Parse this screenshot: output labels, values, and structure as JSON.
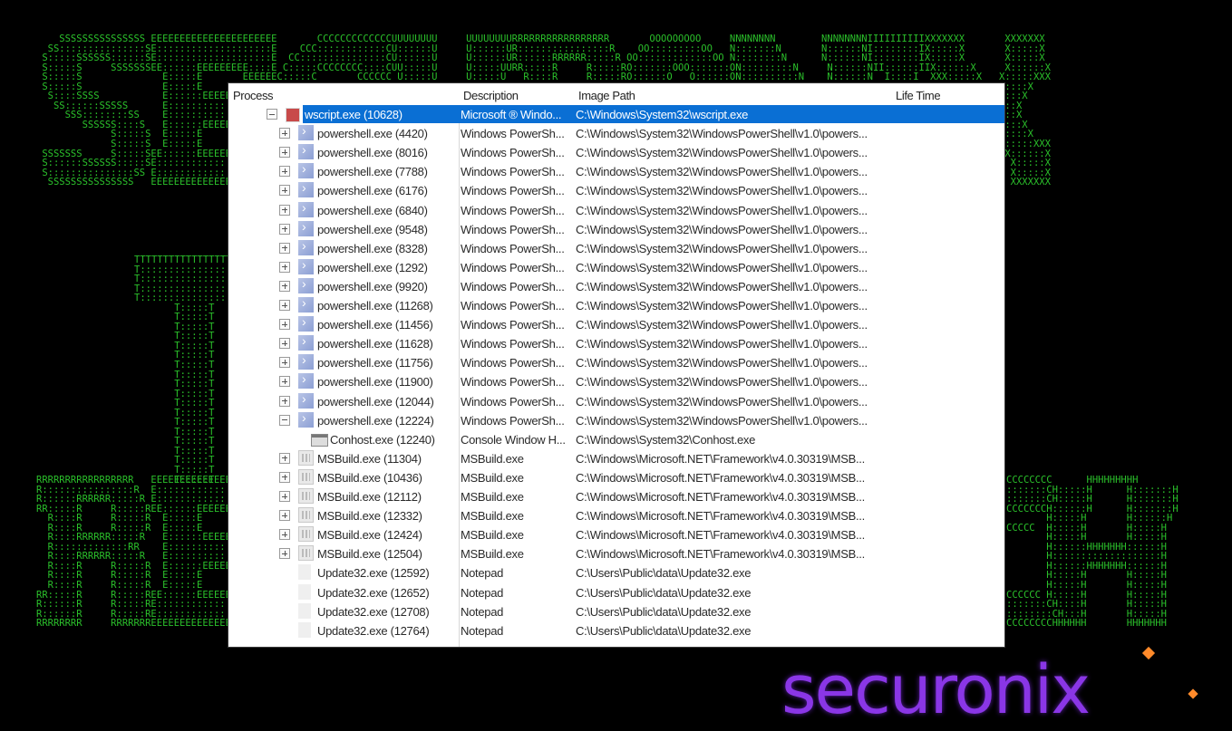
{
  "columns": {
    "process": "Process",
    "description": "Description",
    "image_path": "Image Path",
    "life_time": "Life Time"
  },
  "rows": [
    {
      "name": "wscript.exe (10628)",
      "desc": "Microsoft ® Windo...",
      "path": "C:\\Windows\\System32\\wscript.exe",
      "icon": "script-icon",
      "expander": "minus",
      "selected": true
    },
    {
      "name": "powershell.exe (4420)",
      "desc": "Windows PowerSh...",
      "path": "C:\\Windows\\System32\\WindowsPowerShell\\v1.0\\powers...",
      "icon": "powershell-icon",
      "expander": "plus"
    },
    {
      "name": "powershell.exe (8016)",
      "desc": "Windows PowerSh...",
      "path": "C:\\Windows\\System32\\WindowsPowerShell\\v1.0\\powers...",
      "icon": "powershell-icon",
      "expander": "plus"
    },
    {
      "name": "powershell.exe (7788)",
      "desc": "Windows PowerSh...",
      "path": "C:\\Windows\\System32\\WindowsPowerShell\\v1.0\\powers...",
      "icon": "powershell-icon",
      "expander": "plus"
    },
    {
      "name": "powershell.exe (6176)",
      "desc": "Windows PowerSh...",
      "path": "C:\\Windows\\System32\\WindowsPowerShell\\v1.0\\powers...",
      "icon": "powershell-icon",
      "expander": "plus"
    },
    {
      "name": "powershell.exe (6840)",
      "desc": "Windows PowerSh...",
      "path": "C:\\Windows\\System32\\WindowsPowerShell\\v1.0\\powers...",
      "icon": "powershell-icon",
      "expander": "plus"
    },
    {
      "name": "powershell.exe (9548)",
      "desc": "Windows PowerSh...",
      "path": "C:\\Windows\\System32\\WindowsPowerShell\\v1.0\\powers...",
      "icon": "powershell-icon",
      "expander": "plus"
    },
    {
      "name": "powershell.exe (8328)",
      "desc": "Windows PowerSh...",
      "path": "C:\\Windows\\System32\\WindowsPowerShell\\v1.0\\powers...",
      "icon": "powershell-icon",
      "expander": "plus"
    },
    {
      "name": "powershell.exe (1292)",
      "desc": "Windows PowerSh...",
      "path": "C:\\Windows\\System32\\WindowsPowerShell\\v1.0\\powers...",
      "icon": "powershell-icon",
      "expander": "plus"
    },
    {
      "name": "powershell.exe (9920)",
      "desc": "Windows PowerSh...",
      "path": "C:\\Windows\\System32\\WindowsPowerShell\\v1.0\\powers...",
      "icon": "powershell-icon",
      "expander": "plus"
    },
    {
      "name": "powershell.exe (11268)",
      "desc": "Windows PowerSh...",
      "path": "C:\\Windows\\System32\\WindowsPowerShell\\v1.0\\powers...",
      "icon": "powershell-icon",
      "expander": "plus"
    },
    {
      "name": "powershell.exe (11456)",
      "desc": "Windows PowerSh...",
      "path": "C:\\Windows\\System32\\WindowsPowerShell\\v1.0\\powers...",
      "icon": "powershell-icon",
      "expander": "plus"
    },
    {
      "name": "powershell.exe (11628)",
      "desc": "Windows PowerSh...",
      "path": "C:\\Windows\\System32\\WindowsPowerShell\\v1.0\\powers...",
      "icon": "powershell-icon",
      "expander": "plus"
    },
    {
      "name": "powershell.exe (11756)",
      "desc": "Windows PowerSh...",
      "path": "C:\\Windows\\System32\\WindowsPowerShell\\v1.0\\powers...",
      "icon": "powershell-icon",
      "expander": "plus"
    },
    {
      "name": "powershell.exe (11900)",
      "desc": "Windows PowerSh...",
      "path": "C:\\Windows\\System32\\WindowsPowerShell\\v1.0\\powers...",
      "icon": "powershell-icon",
      "expander": "plus"
    },
    {
      "name": "powershell.exe (12044)",
      "desc": "Windows PowerSh...",
      "path": "C:\\Windows\\System32\\WindowsPowerShell\\v1.0\\powers...",
      "icon": "powershell-icon",
      "expander": "plus"
    },
    {
      "name": "powershell.exe (12224)",
      "desc": "Windows PowerSh...",
      "path": "C:\\Windows\\System32\\WindowsPowerShell\\v1.0\\powers...",
      "icon": "powershell-icon",
      "expander": "minus"
    },
    {
      "name": "Conhost.exe (12240)",
      "desc": "Console Window H...",
      "path": "C:\\Windows\\System32\\Conhost.exe",
      "icon": "console-icon",
      "expander": "none",
      "child": true
    },
    {
      "name": "MSBuild.exe (11304)",
      "desc": "MSBuild.exe",
      "path": "C:\\Windows\\Microsoft.NET\\Framework\\v4.0.30319\\MSB...",
      "icon": "msbuild-icon",
      "expander": "plus"
    },
    {
      "name": "MSBuild.exe (10436)",
      "desc": "MSBuild.exe",
      "path": "C:\\Windows\\Microsoft.NET\\Framework\\v4.0.30319\\MSB...",
      "icon": "msbuild-icon",
      "expander": "plus"
    },
    {
      "name": "MSBuild.exe (12112)",
      "desc": "MSBuild.exe",
      "path": "C:\\Windows\\Microsoft.NET\\Framework\\v4.0.30319\\MSB...",
      "icon": "msbuild-icon",
      "expander": "plus"
    },
    {
      "name": "MSBuild.exe (12332)",
      "desc": "MSBuild.exe",
      "path": "C:\\Windows\\Microsoft.NET\\Framework\\v4.0.30319\\MSB...",
      "icon": "msbuild-icon",
      "expander": "plus"
    },
    {
      "name": "MSBuild.exe (12424)",
      "desc": "MSBuild.exe",
      "path": "C:\\Windows\\Microsoft.NET\\Framework\\v4.0.30319\\MSB...",
      "icon": "msbuild-icon",
      "expander": "plus"
    },
    {
      "name": "MSBuild.exe (12504)",
      "desc": "MSBuild.exe",
      "path": "C:\\Windows\\Microsoft.NET\\Framework\\v4.0.30319\\MSB...",
      "icon": "msbuild-icon",
      "expander": "plus"
    },
    {
      "name": "Update32.exe (12592)",
      "desc": "Notepad",
      "path": "C:\\Users\\Public\\data\\Update32.exe",
      "icon": "notepad-icon",
      "expander": "none"
    },
    {
      "name": "Update32.exe (12652)",
      "desc": "Notepad",
      "path": "C:\\Users\\Public\\data\\Update32.exe",
      "icon": "notepad-icon",
      "expander": "none"
    },
    {
      "name": "Update32.exe (12708)",
      "desc": "Notepad",
      "path": "C:\\Users\\Public\\data\\Update32.exe",
      "icon": "notepad-icon",
      "expander": "none"
    },
    {
      "name": "Update32.exe (12764)",
      "desc": "Notepad",
      "path": "C:\\Users\\Public\\data\\Update32.exe",
      "icon": "notepad-icon",
      "expander": "none"
    }
  ],
  "brand": {
    "text": "securonix",
    "color": "#8a36e6"
  },
  "colors": {
    "selection": "#0a6fd4",
    "ascii_green": "#2fd12f",
    "background": "#000000"
  }
}
